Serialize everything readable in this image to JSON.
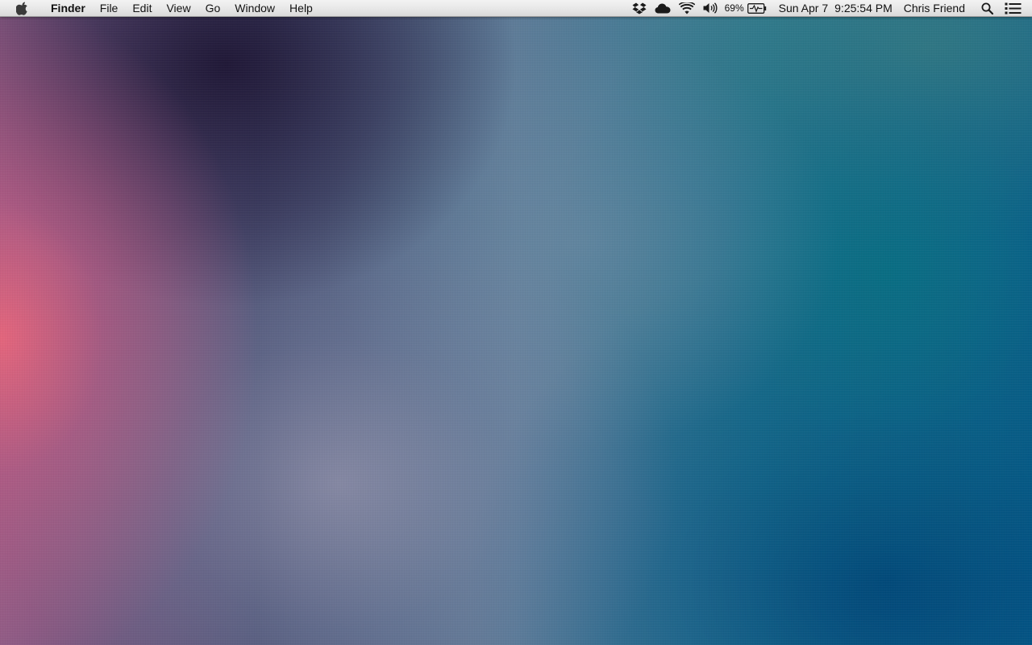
{
  "menubar": {
    "apple_icon": "apple-logo-icon",
    "app_name": "Finder",
    "menus": [
      {
        "label": "File"
      },
      {
        "label": "Edit"
      },
      {
        "label": "View"
      },
      {
        "label": "Go"
      },
      {
        "label": "Window"
      },
      {
        "label": "Help"
      }
    ],
    "status": {
      "icons": [
        "dropbox-icon",
        "icloud-icon",
        "wifi-icon",
        "volume-icon",
        "battery-icon"
      ],
      "battery_percent": "69%",
      "date": "Sun Apr 7",
      "time": "9:25:54 PM",
      "user": "Chris Friend",
      "spotlight_icon": "spotlight-search-icon",
      "notification_icon": "notification-center-icon"
    }
  },
  "desktop": {
    "wallpaper": "blurred-gradient",
    "colors": {
      "left_pink": "#e8667c",
      "dark_plum": "#241e40",
      "lavender_gray": "#8c8fae",
      "teal": "#087082",
      "deep_blue": "#004678"
    }
  }
}
